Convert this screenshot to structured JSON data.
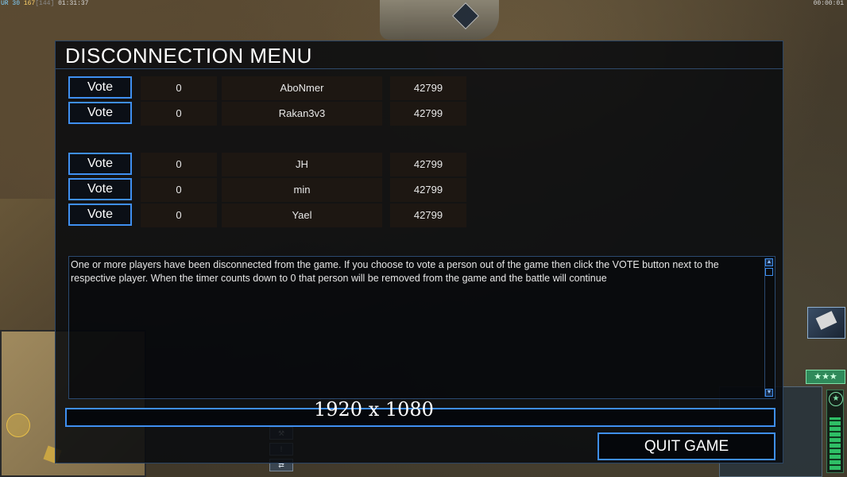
{
  "hud": {
    "ur_label": "UR",
    "ur_value": "30",
    "cap_value": "167",
    "cap_max": "[144]",
    "game_time": "01:31:37",
    "right_timer": "00:00:01"
  },
  "dialog": {
    "title": "DISCONNECTION MENU",
    "vote_label": "Vote",
    "team1": [
      {
        "timer": "0",
        "name": "AboNmer",
        "ping": "42799"
      },
      {
        "timer": "0",
        "name": "Rakan3v3",
        "ping": "42799"
      }
    ],
    "team2": [
      {
        "timer": "0",
        "name": "JH",
        "ping": "42799"
      },
      {
        "timer": "0",
        "name": "min",
        "ping": "42799"
      },
      {
        "timer": "0",
        "name": "Yael",
        "ping": "42799"
      }
    ],
    "message": "One or more players have been disconnected from the game. If you choose to vote a person out of the game then click the VOTE button next to the respective player. When the timer counts down to 0 that person will be removed from the game and the battle will continue",
    "chat_value": "",
    "quit_label": "QUIT GAME"
  },
  "overlay": {
    "resolution": "1920 x 1080"
  },
  "sidebar": {
    "rank_stars": "★★★"
  },
  "colors": {
    "accent_blue": "#3f8ff0",
    "dialog_bg": "#080a0e",
    "power_green": "#2fbf66"
  },
  "icons": [
    "satellite-unit-icon",
    "rank-star-icon",
    "scroll-up-icon",
    "scroll-down-icon"
  ],
  "power_level": 0.85
}
